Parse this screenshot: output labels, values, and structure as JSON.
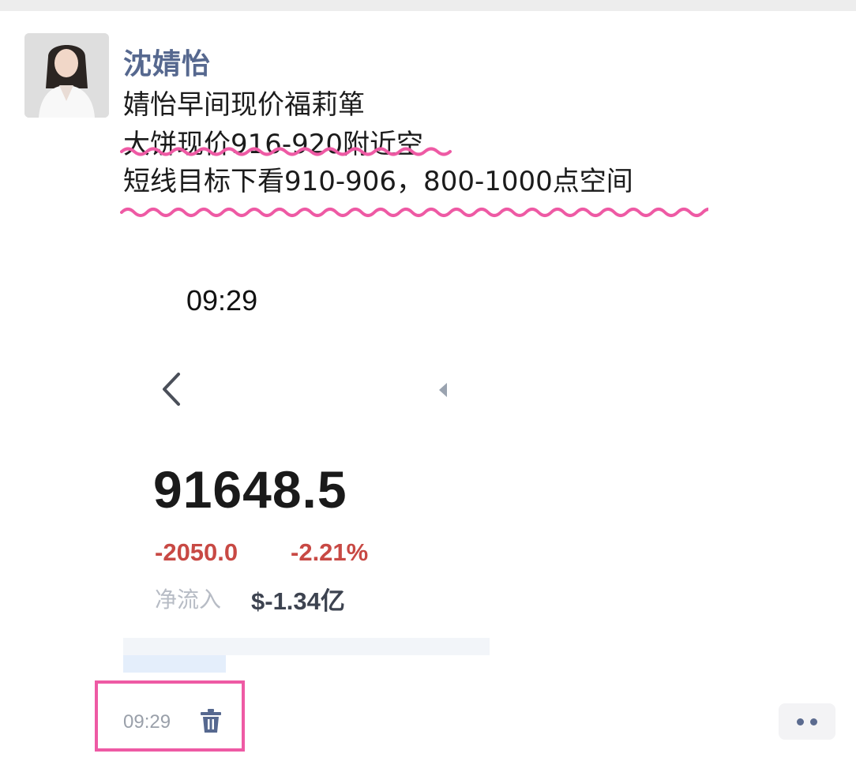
{
  "post": {
    "author": "沈婧怡",
    "lines": [
      "婧怡早间现价福莉箪",
      "大饼现价916-920附近空",
      "短线目标下看910-906，800-1000点空间"
    ],
    "highlight_color": "#ee5aa4"
  },
  "screenshot": {
    "status_time": "09:29",
    "price": "91648.5",
    "change_abs": "-2050.0",
    "change_pct": "-2.21%",
    "net_flow_label": "净流入",
    "net_flow_value": "$-1.34亿",
    "down_color": "#c84944"
  },
  "footer": {
    "time": "09:29",
    "delete_icon": "trash-icon",
    "more_icon": "more-icon"
  }
}
